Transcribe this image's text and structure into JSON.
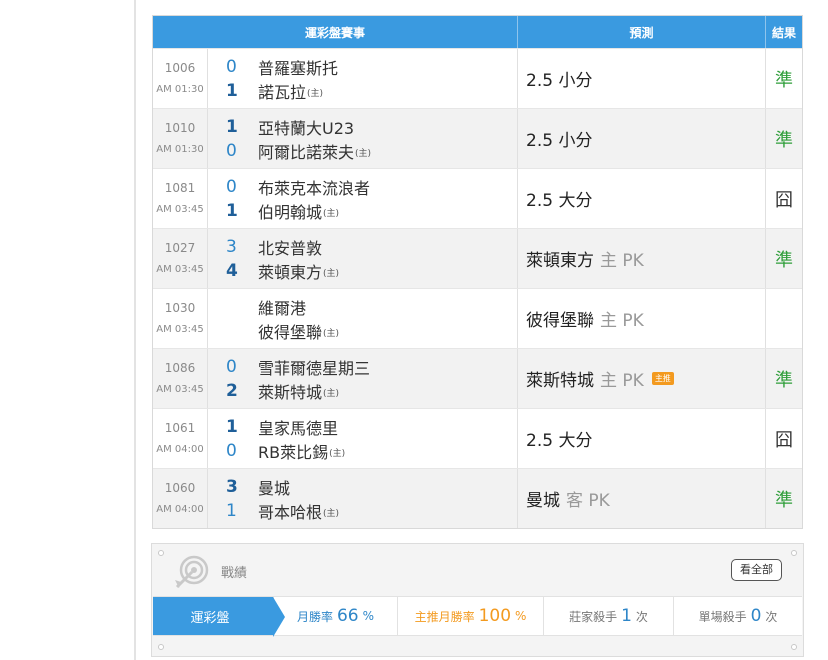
{
  "table": {
    "headers": {
      "match": "運彩盤賽事",
      "prediction": "預測",
      "result": "結果"
    },
    "host_mark": "(主)",
    "rows": [
      {
        "id": "1006",
        "time": "AM 01:30",
        "home_score": "0",
        "away_score": "1",
        "team1": "普羅塞斯托",
        "team2": "諾瓦拉",
        "pred": "2.5 小分",
        "pred_side": "",
        "badge": "",
        "result": "準"
      },
      {
        "id": "1010",
        "time": "AM 01:30",
        "home_score": "1",
        "away_score": "0",
        "team1": "亞特蘭大U23",
        "team2": "阿爾比諾萊夫",
        "pred": "2.5 小分",
        "pred_side": "",
        "badge": "",
        "result": "準"
      },
      {
        "id": "1081",
        "time": "AM 03:45",
        "home_score": "0",
        "away_score": "1",
        "team1": "布萊克本流浪者",
        "team2": "伯明翰城",
        "pred": "2.5 大分",
        "pred_side": "",
        "badge": "",
        "result": "囧"
      },
      {
        "id": "1027",
        "time": "AM 03:45",
        "home_score": "3",
        "away_score": "4",
        "team1": "北安普敦",
        "team2": "萊頓東方",
        "pred": "萊頓東方",
        "pred_side": "主 PK",
        "badge": "",
        "result": "準"
      },
      {
        "id": "1030",
        "time": "AM 03:45",
        "home_score": "",
        "away_score": "",
        "team1": "維爾港",
        "team2": "彼得堡聯",
        "pred": "彼得堡聯",
        "pred_side": "主 PK",
        "badge": "",
        "result": ""
      },
      {
        "id": "1086",
        "time": "AM 03:45",
        "home_score": "0",
        "away_score": "2",
        "team1": "雪菲爾德星期三",
        "team2": "萊斯特城",
        "pred": "萊斯特城",
        "pred_side": "主 PK",
        "badge": "主推",
        "result": "準"
      },
      {
        "id": "1061",
        "time": "AM 04:00",
        "home_score": "1",
        "away_score": "0",
        "team1": "皇家馬德里",
        "team2": "RB萊比錫",
        "pred": "2.5 大分",
        "pred_side": "",
        "badge": "",
        "result": "囧"
      },
      {
        "id": "1060",
        "time": "AM 04:00",
        "home_score": "3",
        "away_score": "1",
        "team1": "曼城",
        "team2": "哥本哈根",
        "pred": "曼城",
        "pred_side": "客 PK",
        "badge": "",
        "result": "準"
      }
    ]
  },
  "record": {
    "title": "戰績",
    "view_all": "看全部",
    "category": "運彩盤",
    "monthly_win": {
      "label": "月勝率",
      "value": "66",
      "unit": "%"
    },
    "pick_win": {
      "label": "主推月勝率",
      "value": "100",
      "unit": "%"
    },
    "banker_killer": {
      "label": "莊家殺手",
      "value": "1",
      "unit": "次"
    },
    "single_killer": {
      "label": "單場殺手",
      "value": "0",
      "unit": "次"
    }
  },
  "colors": {
    "accent": "#3a9ae0",
    "hit": "#2f9e3a",
    "pick": "#f39a1f"
  },
  "icons": [
    "target-icon"
  ]
}
